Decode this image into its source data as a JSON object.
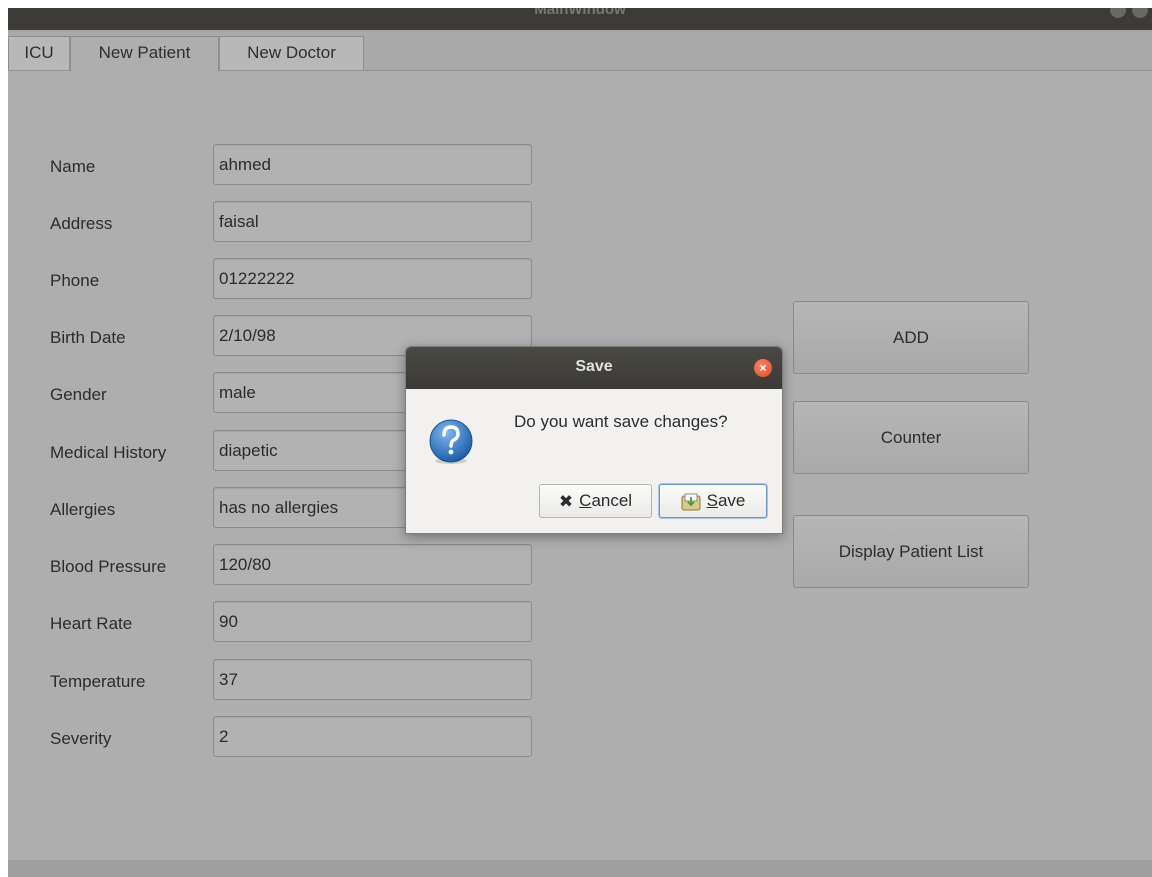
{
  "window": {
    "title": "MainWindow"
  },
  "tabs": [
    {
      "label": "ICU",
      "active": false
    },
    {
      "label": "New Patient",
      "active": true
    },
    {
      "label": "New Doctor",
      "active": false
    }
  ],
  "form": {
    "fields": [
      {
        "label": "Name",
        "value": "ahmed"
      },
      {
        "label": "Address",
        "value": "faisal"
      },
      {
        "label": "Phone",
        "value": "01222222"
      },
      {
        "label": "Birth Date",
        "value": "2/10/98"
      },
      {
        "label": "Gender",
        "value": "male"
      },
      {
        "label": "Medical History",
        "value": "diapetic"
      },
      {
        "label": "Allergies",
        "value": "has no allergies"
      },
      {
        "label": "Blood Pressure",
        "value": "120/80"
      },
      {
        "label": "Heart Rate",
        "value": "90"
      },
      {
        "label": "Temperature",
        "value": "37"
      },
      {
        "label": "Severity",
        "value": "2"
      }
    ]
  },
  "actions": {
    "add_label": "ADD",
    "counter_label": "Counter",
    "display_list_label": "Display Patient List"
  },
  "dialog": {
    "title": "Save",
    "icon": "question-icon",
    "message": "Do you want save changes?",
    "cancel_prefix": "",
    "cancel_mnemonic": "C",
    "cancel_rest": "ancel",
    "save_mnemonic": "S",
    "save_rest": "ave"
  },
  "colors": {
    "window_bg": "#aeaeae",
    "titlebar_bg": "#3d3b37",
    "dialog_bg": "#f2f1f0",
    "close_button": "#df4b20",
    "default_button_border": "#6e95c4"
  }
}
